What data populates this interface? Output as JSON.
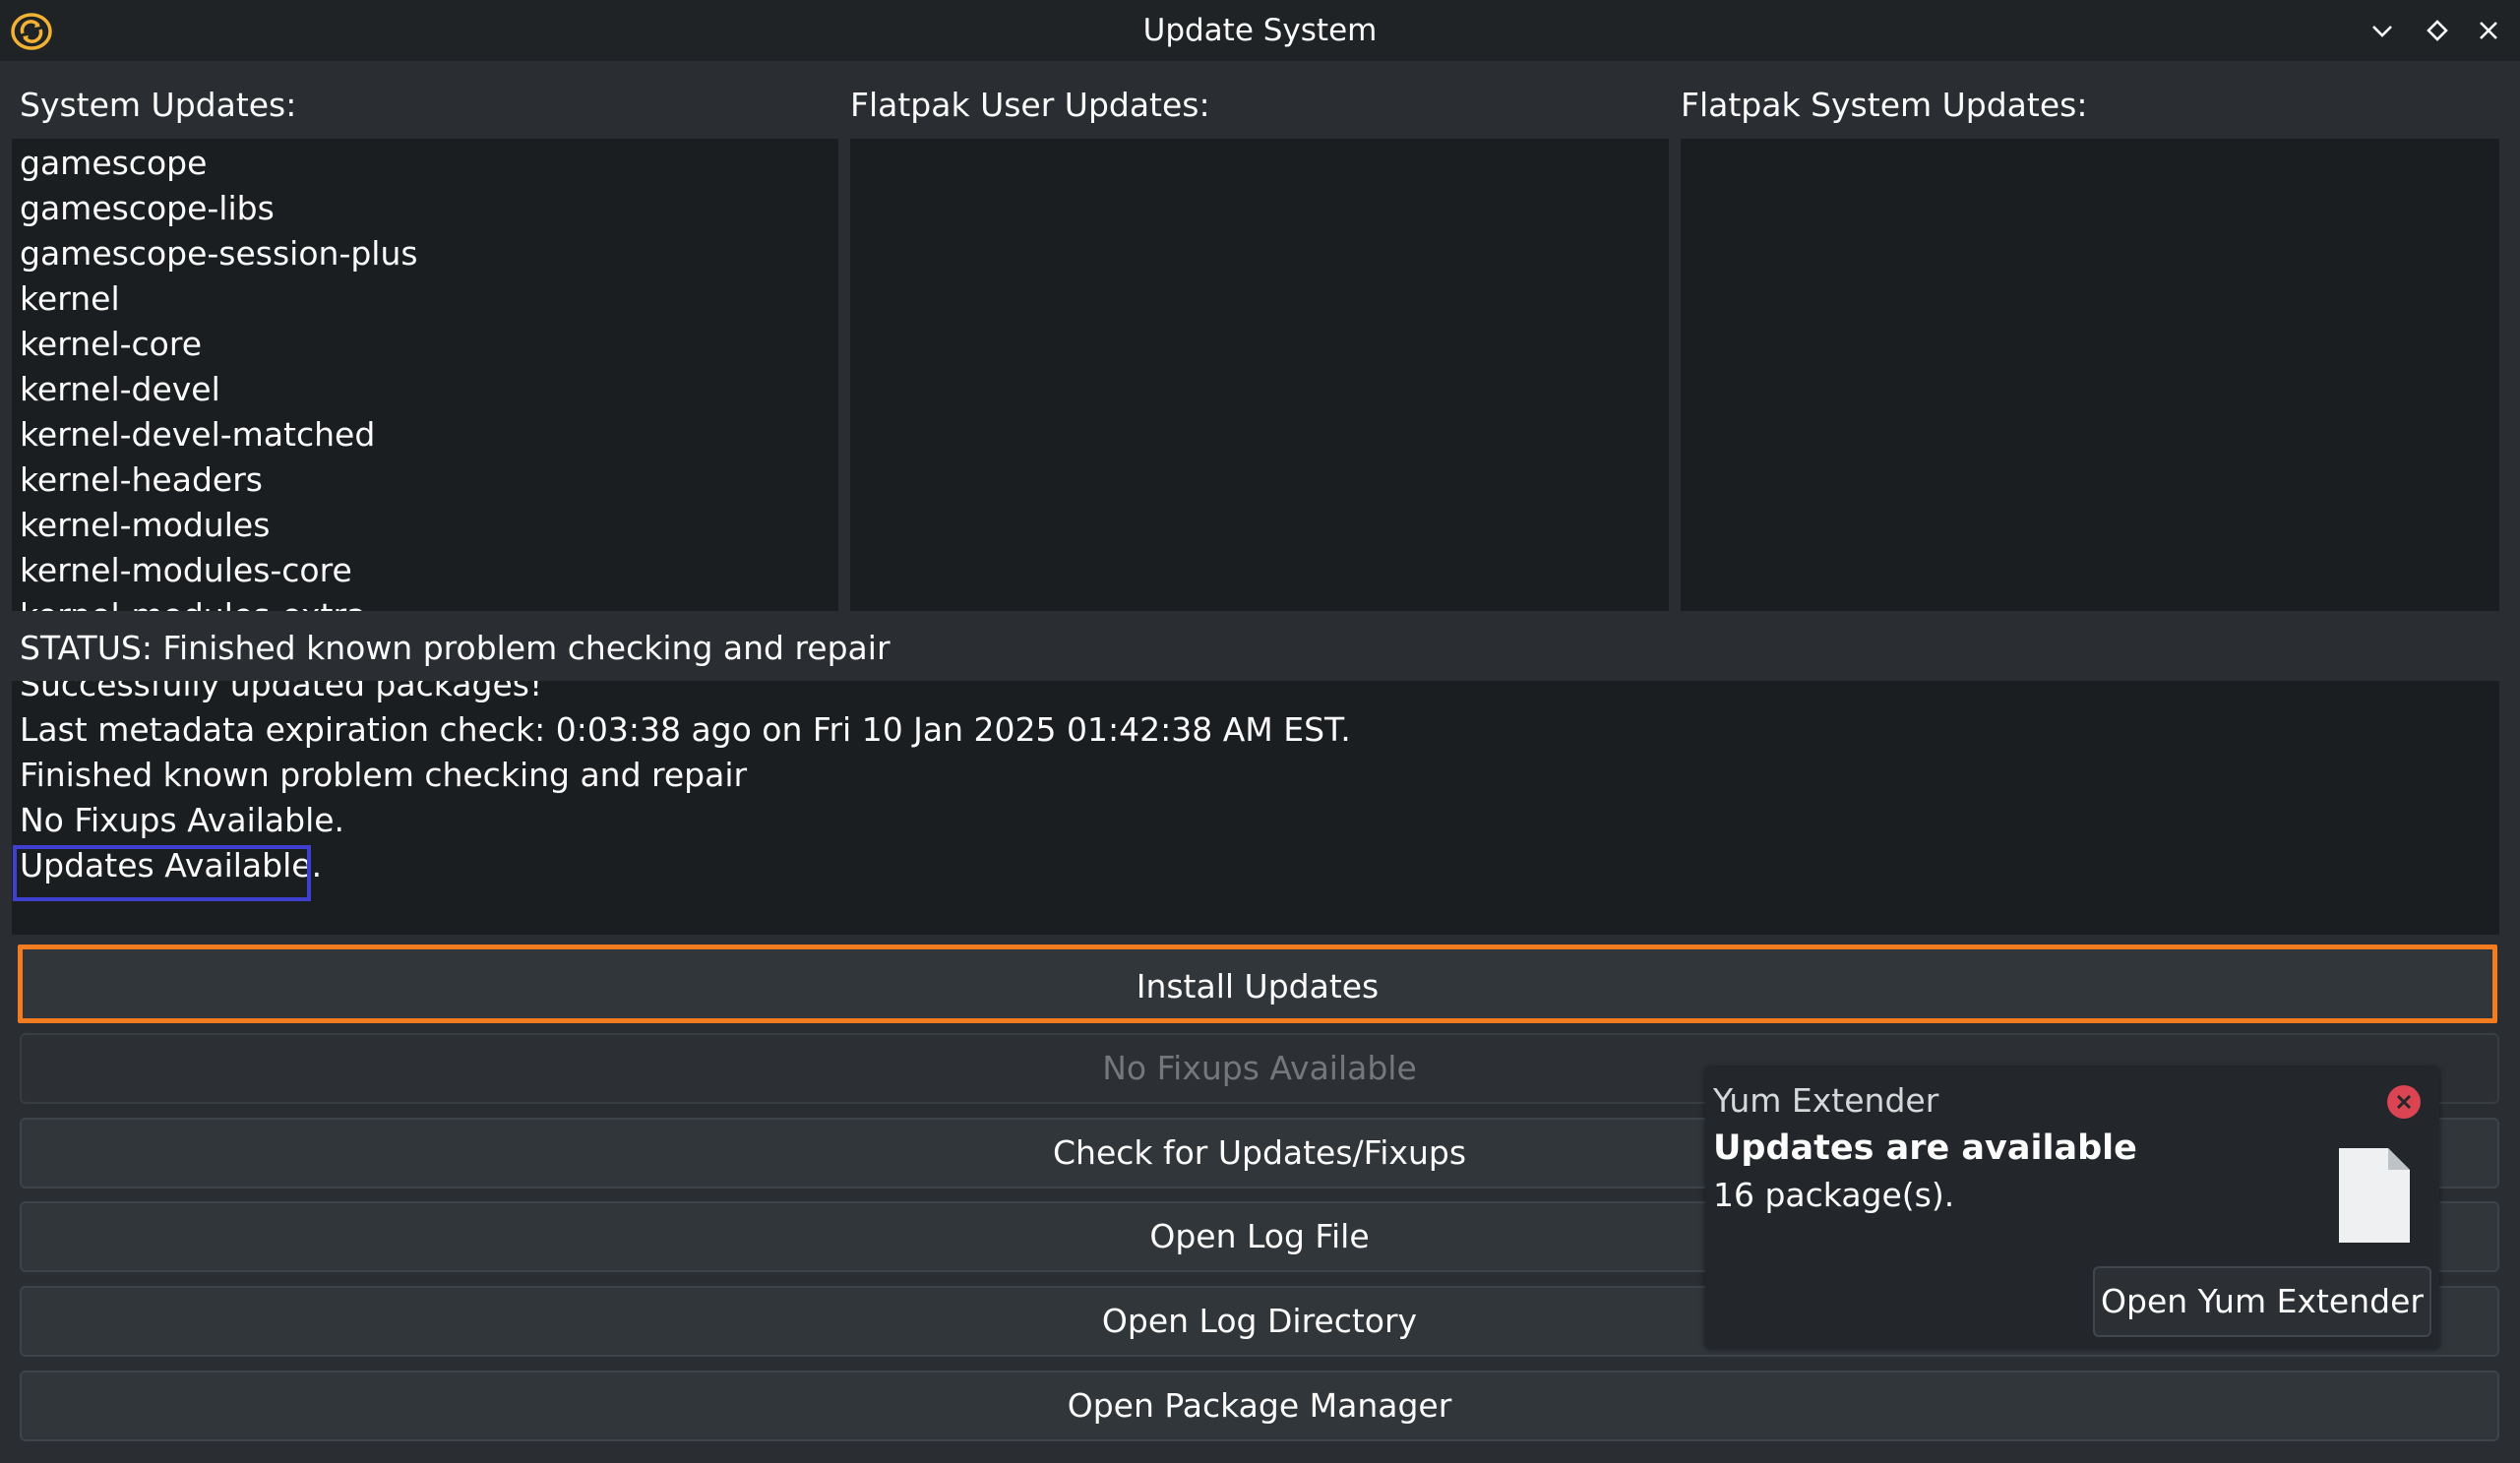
{
  "window": {
    "title": "Update System",
    "app_icon": "refresh-logo-icon",
    "controls": [
      "chevron-down-icon",
      "diamond-icon",
      "close-icon"
    ]
  },
  "lists": {
    "system": {
      "label": "System Updates:",
      "items": [
        "gamescope",
        "gamescope-libs",
        "gamescope-session-plus",
        "kernel",
        "kernel-core",
        "kernel-devel",
        "kernel-devel-matched",
        "kernel-headers",
        "kernel-modules",
        "kernel-modules-core",
        "kernel-modules-extra"
      ]
    },
    "flatpak_user": {
      "label": "Flatpak User Updates:",
      "items": []
    },
    "flatpak_system": {
      "label": "Flatpak System Updates:",
      "items": []
    }
  },
  "status": {
    "text": "STATUS: Finished known problem checking and repair"
  },
  "log": {
    "lines": [
      "Successfully updated packages!",
      "Last metadata expiration check: 0:03:38 ago on Fri 10 Jan 2025 01:42:38 AM EST.",
      "Finished known problem checking and repair",
      "No Fixups Available.",
      "Updates Available."
    ]
  },
  "buttons": {
    "install": "Install Updates",
    "fixups": "No Fixups Available",
    "check": "Check for Updates/Fixups",
    "open_log_file": "Open Log File",
    "open_log_dir": "Open Log Directory",
    "open_pkg_mgr": "Open Package Manager"
  },
  "notification": {
    "app": "Yum Extender",
    "title": "Updates are available",
    "body": "16 package(s).",
    "action": "Open Yum Extender",
    "icon": "file-icon"
  },
  "colors": {
    "accent_orange": "#f47c20",
    "highlight_blue": "#3f3fd0",
    "close_red": "#da4453",
    "window_bg": "#2a2e32",
    "list_bg": "#1b1e20"
  }
}
